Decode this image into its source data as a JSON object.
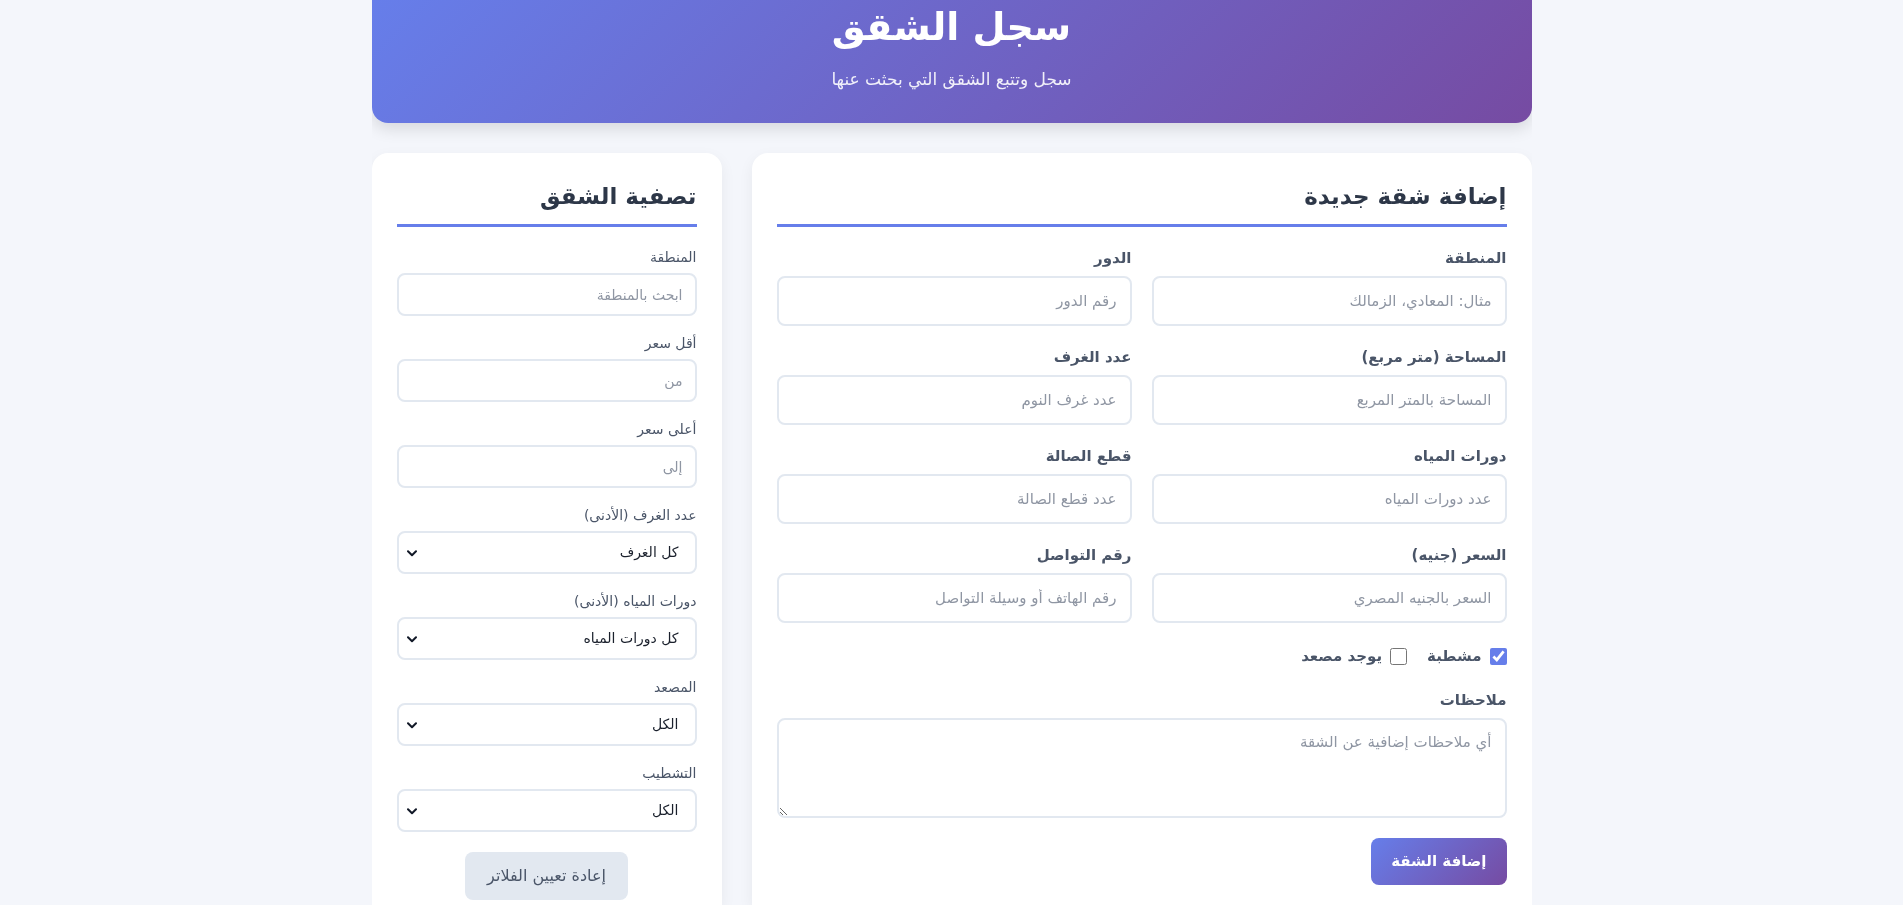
{
  "header": {
    "title": "سجل الشقق",
    "subtitle": "سجل وتتبع الشقق التي بحثت عنها"
  },
  "add_form": {
    "title": "إضافة شقة جديدة",
    "fields": [
      {
        "label": "المنطقة",
        "placeholder": "مثال: المعادي، الزمالك"
      },
      {
        "label": "الدور",
        "placeholder": "رقم الدور"
      },
      {
        "label": "المساحة (متر مربع)",
        "placeholder": "المساحة بالمتر المربع"
      },
      {
        "label": "عدد الغرف",
        "placeholder": "عدد غرف النوم"
      },
      {
        "label": "دورات المياه",
        "placeholder": "عدد دورات المياه"
      },
      {
        "label": "قطع الصالة",
        "placeholder": "عدد قطع الصالة"
      },
      {
        "label": "السعر (جنيه)",
        "placeholder": "السعر بالجنيه المصري"
      },
      {
        "label": "رقم التواصل",
        "placeholder": "رقم الهاتف أو وسيلة التواصل"
      }
    ],
    "checkboxes": [
      {
        "label": "مشطبة",
        "checked": true
      },
      {
        "label": "يوجد مصعد",
        "checked": false
      }
    ],
    "notes": {
      "label": "ملاحظات",
      "placeholder": "أي ملاحظات إضافية عن الشقة"
    },
    "submit_button": "إضافة الشقة"
  },
  "filters": {
    "title": "تصفية الشقق",
    "fields": [
      {
        "kind": "input",
        "label": "المنطقة",
        "placeholder": "ابحث بالمنطقة"
      },
      {
        "kind": "input",
        "label": "أقل سعر",
        "placeholder": "من"
      },
      {
        "kind": "input",
        "label": "أعلى سعر",
        "placeholder": "إلى"
      },
      {
        "kind": "select",
        "label": "عدد الغرف (الأدنى)",
        "value": "كل الغرف"
      },
      {
        "kind": "select",
        "label": "دورات المياه (الأدنى)",
        "value": "كل دورات المياه"
      },
      {
        "kind": "select",
        "label": "المصعد",
        "value": "الكل"
      },
      {
        "kind": "select",
        "label": "التشطيب",
        "value": "الكل"
      }
    ],
    "reset_button": "إعادة تعيين الفلاتر"
  }
}
